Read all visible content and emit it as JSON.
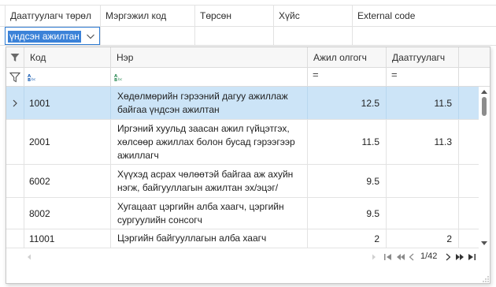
{
  "background": {
    "columns": [
      "Даатгуулагч төрөл",
      "Мэргэжил код",
      "Төрсөн",
      "Хүйс",
      "External code"
    ],
    "combo_value": "үндсэн ажилтан"
  },
  "dropdown": {
    "columns": [
      "Код",
      "Нэр",
      "Ажил олгогч",
      "Даатгуулагч"
    ],
    "filter_badges": [
      "ABC",
      "ABC"
    ],
    "filter_operators": [
      "=",
      "="
    ],
    "rows": [
      {
        "code": "1001",
        "name": "Хөдөлмөрийн гэрээний дагуу ажиллаж байгаа үндсэн ажилтан",
        "employer": "12.5",
        "insured": "11.5"
      },
      {
        "code": "2001",
        "name": "Иргэний хуульд заасан ажил гүйцэтгэх, хөлсөөр ажиллах болон бусад  гэрээгээр ажиллагч",
        "employer": "11.5",
        "insured": "11.3"
      },
      {
        "code": "6002",
        "name": "Хүүхэд асрах чөлөөтэй байгаа аж ахуйн нэгж, байгууллагын ажилтан эх/эцэг/",
        "employer": "9.5",
        "insured": ""
      },
      {
        "code": "8002",
        "name": "Хугацаат цэргийн алба хаагч, цэргийн сургуулийн сонсогч",
        "employer": "9.5",
        "insured": ""
      },
      {
        "code": "11001",
        "name": "Цэргийн байгууллагын алба хаагч",
        "employer": "2",
        "insured": "2"
      }
    ],
    "pager": "1/42",
    "selected_row_index": 0
  },
  "colors": {
    "selection": "#cce4f7",
    "accent": "#2f7cd3",
    "badge_blue": "#1a5fb4",
    "badge_green": "#2e8b57"
  }
}
